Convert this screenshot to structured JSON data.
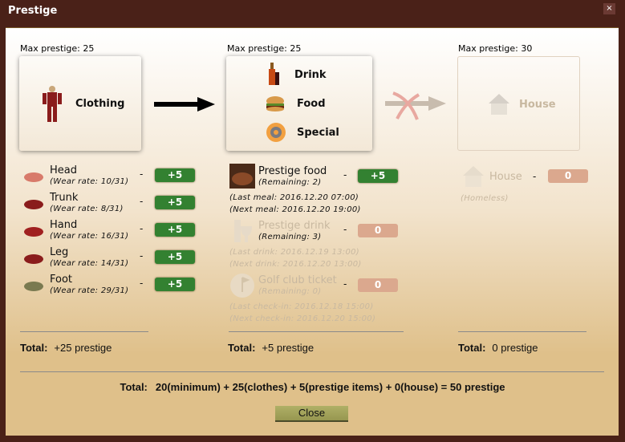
{
  "window": {
    "title": "Prestige",
    "close_icon": "×"
  },
  "clothing": {
    "max": "Max prestige: 25",
    "label": "Clothing",
    "items": [
      {
        "name": "Head",
        "rate": "(Wear rate: 10/31)",
        "value": "+5"
      },
      {
        "name": "Trunk",
        "rate": "(Wear rate: 8/31)",
        "value": "+5"
      },
      {
        "name": "Hand",
        "rate": "(Wear rate: 16/31)",
        "value": "+5"
      },
      {
        "name": "Leg",
        "rate": "(Wear rate: 14/31)",
        "value": "+5"
      },
      {
        "name": "Foot",
        "rate": "(Wear rate: 29/31)",
        "value": "+5"
      }
    ],
    "total_label": "Total:",
    "total": "+25 prestige"
  },
  "items": {
    "max": "Max prestige: 25",
    "labels": [
      "Drink",
      "Food",
      "Special"
    ],
    "food": {
      "name": "Prestige food",
      "remaining": "(Remaining: 2)",
      "value": "+5",
      "last": "(Last meal: 2016.12.20 07:00)",
      "next": "(Next meal: 2016.12.20 19:00)"
    },
    "drink": {
      "name": "Prestige drink",
      "remaining": "(Remaining: 3)",
      "value": "0",
      "last": "(Last drink: 2016.12.19 13:00)",
      "next": "(Next drink: 2016.12.20 13:00)"
    },
    "golf": {
      "name": "Golf club ticket",
      "remaining": "(Remaining: 0)",
      "value": "0",
      "last": "(Last check-in: 2016.12.18 15:00)",
      "next": "(Next check-in: 2016.12.20 15:00)"
    },
    "total_label": "Total:",
    "total": "+5 prestige"
  },
  "house": {
    "max": "Max prestige: 30",
    "label": "House",
    "name": "House",
    "status": "(Homeless)",
    "value": "0",
    "total_label": "Total:",
    "total": "0 prestige"
  },
  "dash": "-",
  "grand": {
    "label": "Total:",
    "text": "20(minimum) + 25(clothes) + 5(prestige items) + 0(house) = 50 prestige"
  },
  "close_label": "Close",
  "colors": {
    "active": "#338131",
    "inactive": "#dba88e",
    "titlebar": "#4a2118"
  }
}
